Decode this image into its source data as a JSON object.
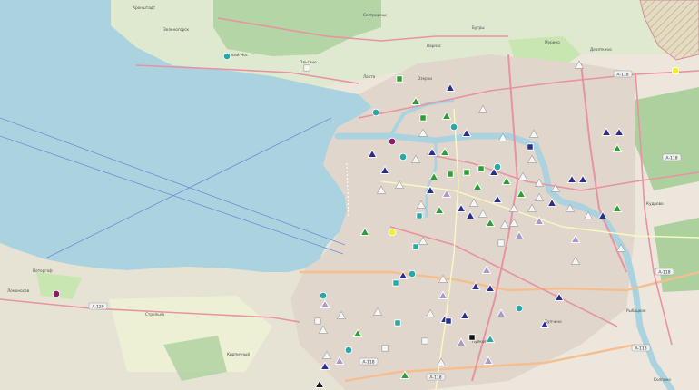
{
  "map": {
    "colors": {
      "water": "#aad3df",
      "land": "#ece6dc",
      "urban": "#e0d6cc",
      "park": "#c8e6b0",
      "forest": "#add19e",
      "farmland": "#eef0d5",
      "road_major": "#e892a2",
      "road_trunk": "#f6be8e",
      "road_secondary": "#f7fabf",
      "ferry": "#6f8fd8",
      "restricted": "#e7a3a8"
    },
    "marker_colors": {
      "navy": "#2a2f8f",
      "green": "#2e9e36",
      "teal": "#2aa7a7",
      "white": "#f6f6f6",
      "lavender": "#a79bc8",
      "purple": "#8a1c6b",
      "yellow": "#f1ef2b",
      "black": "#111111"
    },
    "highway_shields": [
      "A-118",
      "A-118",
      "A-118",
      "A-118",
      "A-118",
      "A-118",
      "A-120"
    ],
    "labels": [
      "Кронштадт",
      "Петергоф",
      "Ломоносов",
      "Стрельна",
      "Сестрорецк",
      "Зеленогорск",
      "Лисий Нос",
      "Ольгино",
      "Лахта",
      "Пулково",
      "Купчино",
      "Рыбацкое",
      "Кудрово",
      "Мурино",
      "Бугры",
      "Девяткино",
      "Парнас",
      "Кирпичный",
      "Озерки",
      "Колпино"
    ]
  }
}
